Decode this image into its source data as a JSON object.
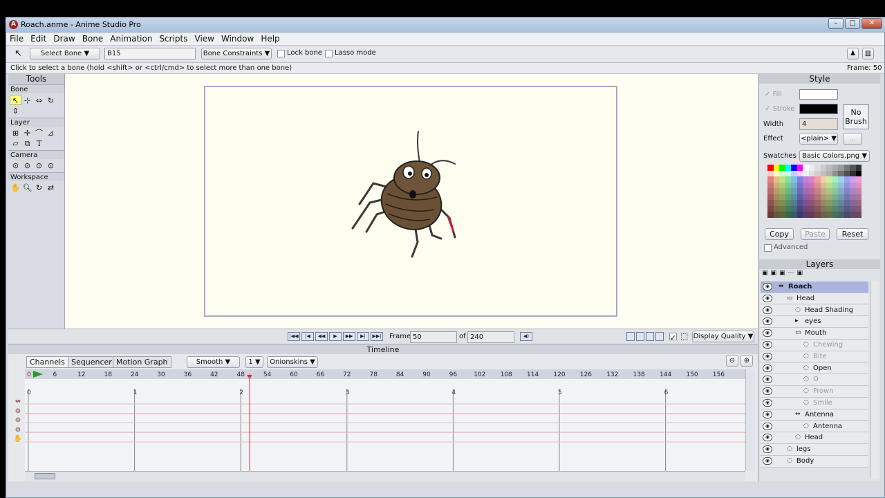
{
  "window": {
    "title": "Roach.anme - Anime Studio Pro",
    "app_icon": "A"
  },
  "menu": [
    "File",
    "Edit",
    "Draw",
    "Bone",
    "Animation",
    "Scripts",
    "View",
    "Window",
    "Help"
  ],
  "toolbar": {
    "tool_select": "Select Bone",
    "bone_name": "B15",
    "constraints": "Bone Constraints",
    "lock_bone": "Lock bone",
    "lasso_mode": "Lasso mode"
  },
  "hint": "Click to select a bone (hold <shift> or <ctrl/cmd> to select more than one bone)",
  "frame_status": "Frame: 50",
  "tools": {
    "title": "Tools",
    "sections": [
      "Bone",
      "Layer",
      "Camera",
      "Workspace"
    ]
  },
  "playback": {
    "frame_label": "Frame",
    "frame_value": "50",
    "of_label": "of",
    "total_frames": "240",
    "display_quality": "Display Quality"
  },
  "timeline": {
    "title": "Timeline",
    "tabs": [
      "Channels",
      "Sequencer",
      "Motion Graph"
    ],
    "interp": "Smooth",
    "interp_count": "1",
    "onionskins": "Onionskins",
    "ruler_start": "0",
    "ruler_ticks": [
      "6",
      "12",
      "18",
      "24",
      "30",
      "36",
      "42",
      "48",
      "54",
      "60",
      "66",
      "72",
      "78",
      "84",
      "90",
      "96",
      "102",
      "108",
      "114",
      "120",
      "126",
      "132",
      "138",
      "144",
      "150",
      "156"
    ],
    "second_marks": [
      "0",
      "1",
      "2",
      "3",
      "4",
      "5",
      "6"
    ]
  },
  "style": {
    "title": "Style",
    "fill_label": "Fill",
    "stroke_label": "Stroke",
    "width_label": "Width",
    "width_value": "4",
    "effect_label": "Effect",
    "effect_value": "<plain>",
    "effect_more": "...",
    "no_brush": "No Brush",
    "swatches_label": "Swatches",
    "swatches_value": "Basic Colors.png",
    "copy": "Copy",
    "paste": "Paste",
    "reset": "Reset",
    "advanced": "Advanced",
    "fill_color": "#ffffff",
    "stroke_color": "#000000"
  },
  "layers": {
    "title": "Layers",
    "items": [
      "Roach",
      "Head",
      "Head Shading",
      "eyes",
      "Mouth",
      "Chewing",
      "Bite",
      "Open",
      "O",
      "Frown",
      "Smile",
      "Antenna",
      "Antenna",
      "Head",
      "legs",
      "Body"
    ]
  }
}
